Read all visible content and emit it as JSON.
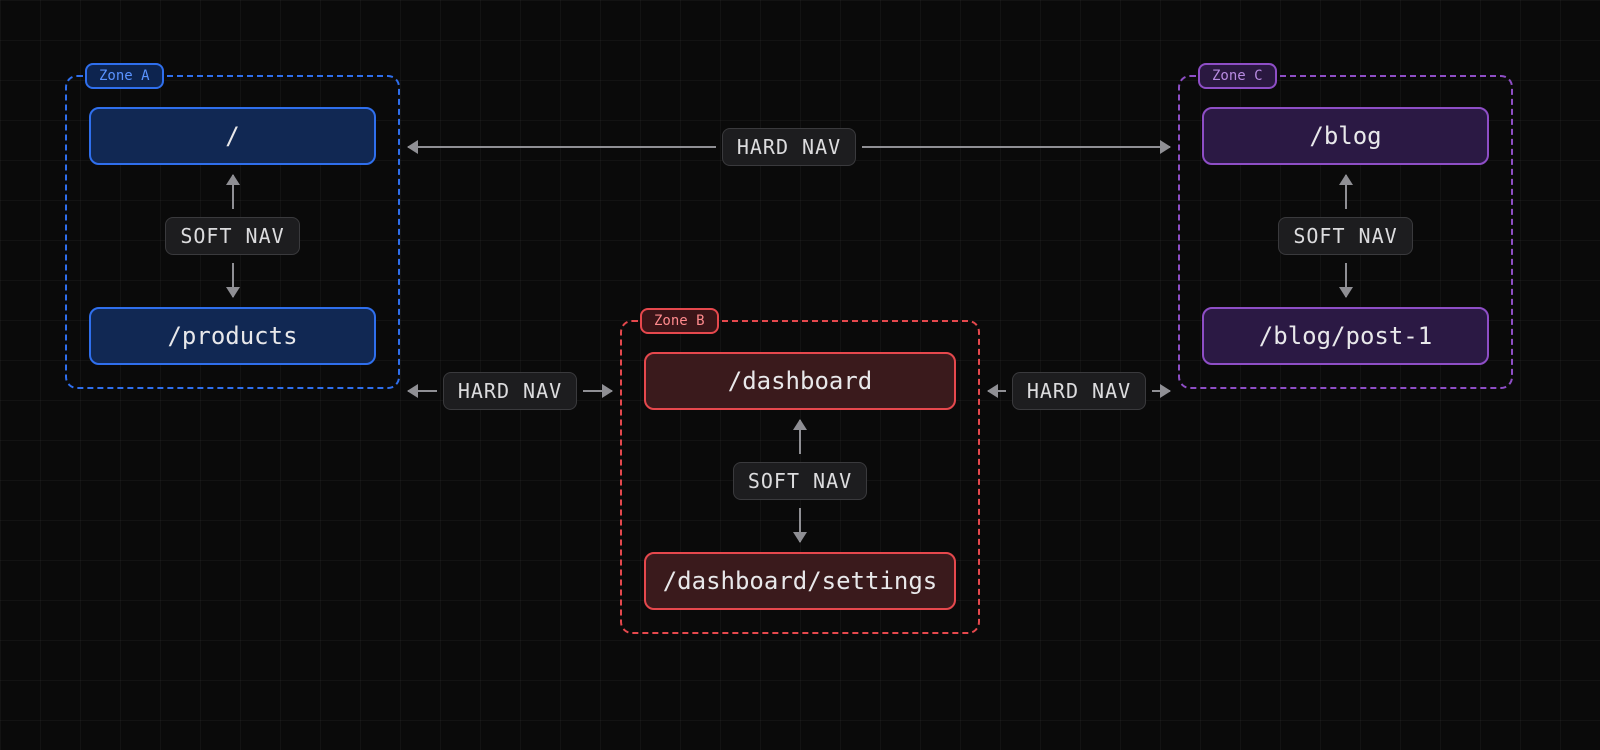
{
  "labels": {
    "soft_nav": "SOFT NAV",
    "hard_nav": "HARD NAV"
  },
  "zones": {
    "a": {
      "title": "Zone A",
      "color": "#2f6fed",
      "routes": [
        "/",
        "/products"
      ]
    },
    "b": {
      "title": "Zone B",
      "color": "#e5484d",
      "routes": [
        "/dashboard",
        "/dashboard/settings"
      ]
    },
    "c": {
      "title": "Zone C",
      "color": "#8e4ec6",
      "routes": [
        "/blog",
        "/blog/post-1"
      ]
    }
  },
  "connections": [
    {
      "from": "a.routes.0",
      "to": "a.routes.1",
      "type": "soft"
    },
    {
      "from": "b.routes.0",
      "to": "b.routes.1",
      "type": "soft"
    },
    {
      "from": "c.routes.0",
      "to": "c.routes.1",
      "type": "soft"
    },
    {
      "from": "a",
      "to": "c",
      "type": "hard"
    },
    {
      "from": "a",
      "to": "b",
      "type": "hard"
    },
    {
      "from": "b",
      "to": "c",
      "type": "hard"
    }
  ]
}
